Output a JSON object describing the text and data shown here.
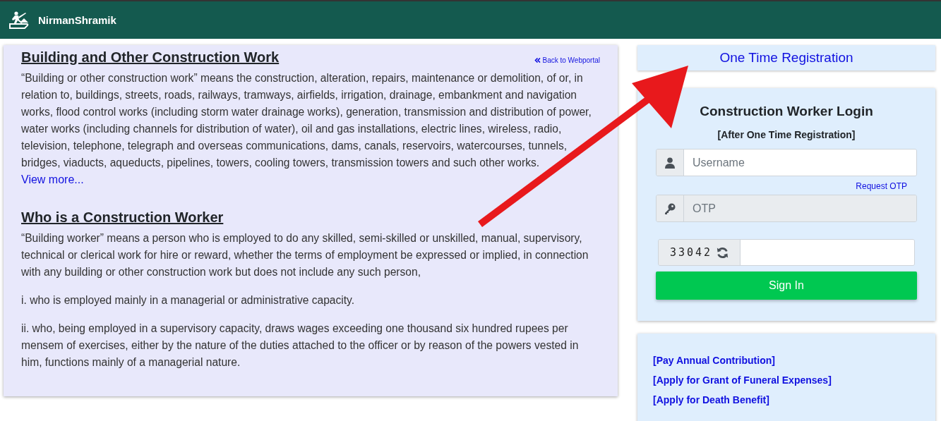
{
  "header": {
    "brand": "NirmanShramik"
  },
  "info": {
    "back_link": "Back to Webportal",
    "sections": [
      {
        "heading": "Building and Other Construction Work",
        "paragraphs": [
          "“Building or other construction work” means the construction, alteration, repairs, maintenance or demolition, of or, in relation to, buildings, streets, roads, railways, tramways, airfields, irrigation, drainage, embankment and navigation works, flood control works (including storm water drainage works), generation, transmission and distribution of power, water works (including channels for distribution of water), oil and gas installations, electric lines, wireless, radio, television, telephone, telegraph and overseas communications, dams, canals, reservoirs, watercourses, tunnels, bridges, viaducts, aqueducts, pipelines, towers, cooling towers, transmission towers and such other works."
        ],
        "more_link": "View more..."
      },
      {
        "heading": "Who is a Construction Worker",
        "paragraphs": [
          "“Building worker” means a person who is employed to do any skilled, semi-skilled or unskilled, manual, supervisory, technical or clerical work for hire or reward, whether the terms of employment be expressed or implied, in connection with any building or other construction work but does not include any such person,",
          "i. who is employed mainly in a managerial or administrative capacity.",
          "ii. who, being employed in a supervisory capacity, draws wages exceeding one thousand six hundred rupees per mensem of exercises, either by the nature of the duties attached to the officer or by reason of the powers vested in him, functions mainly of a managerial nature."
        ]
      }
    ]
  },
  "registration_link": "One Time Registration",
  "login": {
    "title": "Construction Worker Login",
    "subtitle": "[After One Time Registration]",
    "username": {
      "placeholder": "Username"
    },
    "request_otp": "Request OTP",
    "otp": {
      "placeholder": "OTP",
      "disabled": true
    },
    "captcha": "33042",
    "sign_in": "Sign In"
  },
  "quick_links": [
    "[Pay Annual Contribution]",
    "[Apply for Grant of Funeral Expenses]",
    "[Apply for Death Benefit]"
  ]
}
